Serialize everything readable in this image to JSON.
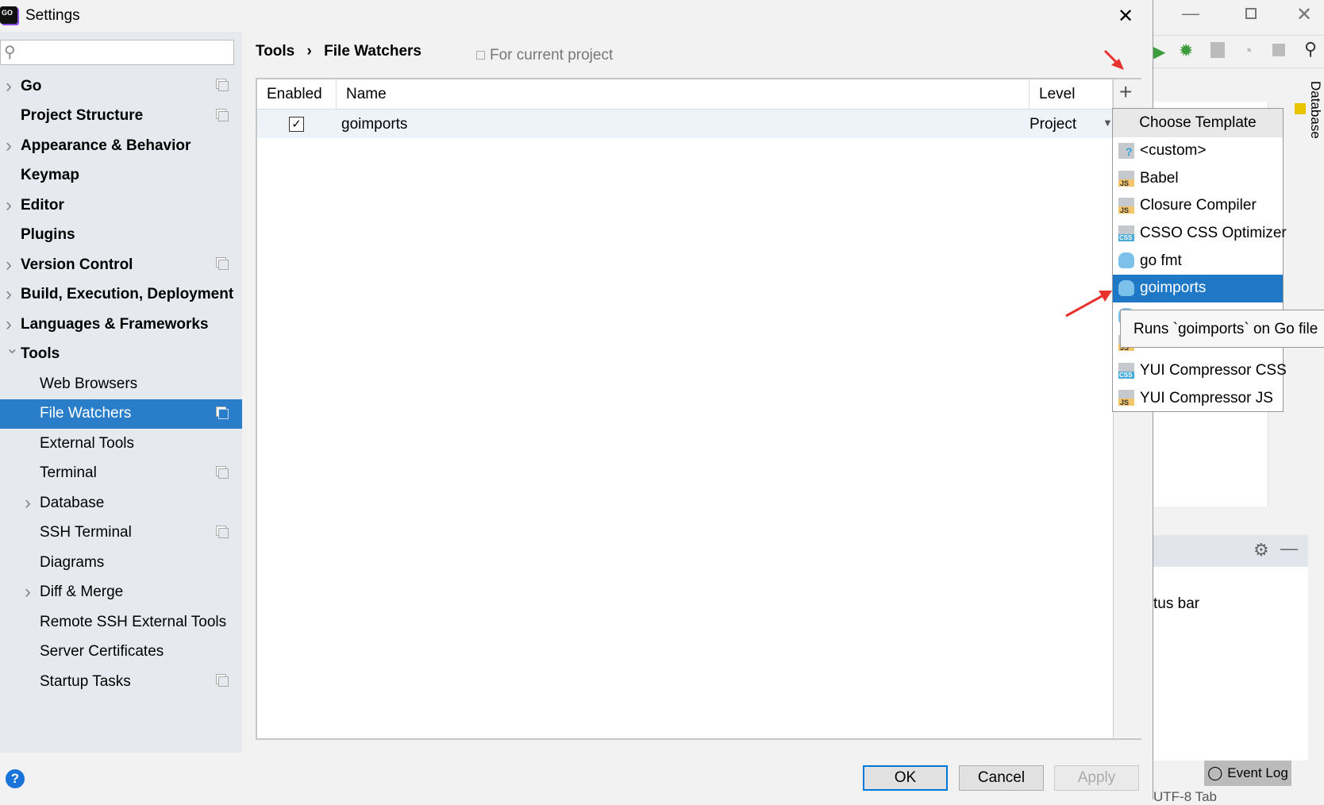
{
  "window": {
    "title": "Settings",
    "app_icon": "goland-logo"
  },
  "search": {
    "placeholder": "",
    "value": ""
  },
  "sidebar": {
    "items": [
      {
        "label": "Go",
        "bold": true,
        "expandable": true,
        "project": true
      },
      {
        "label": "Project Structure",
        "bold": true,
        "expandable": false,
        "project": true
      },
      {
        "label": "Appearance & Behavior",
        "bold": true,
        "expandable": true,
        "project": false
      },
      {
        "label": "Keymap",
        "bold": true,
        "expandable": false,
        "project": false
      },
      {
        "label": "Editor",
        "bold": true,
        "expandable": true,
        "project": false
      },
      {
        "label": "Plugins",
        "bold": true,
        "expandable": false,
        "project": false
      },
      {
        "label": "Version Control",
        "bold": true,
        "expandable": true,
        "project": true
      },
      {
        "label": "Build, Execution, Deployment",
        "bold": true,
        "expandable": true,
        "project": false
      },
      {
        "label": "Languages & Frameworks",
        "bold": true,
        "expandable": true,
        "project": false
      },
      {
        "label": "Tools",
        "bold": true,
        "expandable": true,
        "expanded": true,
        "project": false
      },
      {
        "label": "Web Browsers",
        "child": true,
        "project": false
      },
      {
        "label": "File Watchers",
        "child": true,
        "project": true,
        "selected": true
      },
      {
        "label": "External Tools",
        "child": true,
        "project": false
      },
      {
        "label": "Terminal",
        "child": true,
        "project": true
      },
      {
        "label": "Database",
        "child": true,
        "expandable": true,
        "project": false
      },
      {
        "label": "SSH Terminal",
        "child": true,
        "project": true
      },
      {
        "label": "Diagrams",
        "child": true,
        "project": false
      },
      {
        "label": "Diff & Merge",
        "child": true,
        "expandable": true,
        "project": false
      },
      {
        "label": "Remote SSH External Tools",
        "child": true,
        "project": false
      },
      {
        "label": "Server Certificates",
        "child": true,
        "project": false
      },
      {
        "label": "Startup Tasks",
        "child": true,
        "project": true
      }
    ]
  },
  "breadcrumb": {
    "parent": "Tools",
    "separator": "›",
    "current": "File Watchers",
    "scope": "For current project"
  },
  "table": {
    "columns": [
      "Enabled",
      "Name",
      "Level"
    ],
    "add_label": "+",
    "rows": [
      {
        "enabled": true,
        "name": "goimports",
        "level": "Project"
      }
    ]
  },
  "popup": {
    "title": "Choose Template",
    "items": [
      {
        "label": "<custom>",
        "icon": "custom"
      },
      {
        "label": "Babel",
        "icon": "js"
      },
      {
        "label": "Closure Compiler",
        "icon": "js"
      },
      {
        "label": "CSSO CSS Optimizer",
        "icon": "css"
      },
      {
        "label": "go fmt",
        "icon": "go"
      },
      {
        "label": "goimports",
        "icon": "go",
        "selected": true
      },
      {
        "label": "",
        "icon": "go"
      },
      {
        "label": "",
        "icon": "js"
      },
      {
        "label": "YUI Compressor CSS",
        "icon": "css"
      },
      {
        "label": "YUI Compressor JS",
        "icon": "js"
      }
    ]
  },
  "tooltip": "Runs `goimports` on Go file",
  "buttons": {
    "ok": "OK",
    "cancel": "Cancel",
    "apply": "Apply"
  },
  "ide": {
    "side_tab": "Database",
    "status_text": "tus bar",
    "event_log": "Event Log",
    "status_bar": "UTF-8  Tab"
  },
  "colors": {
    "selection": "#2a7ec9",
    "annotation": "#e8322f"
  }
}
